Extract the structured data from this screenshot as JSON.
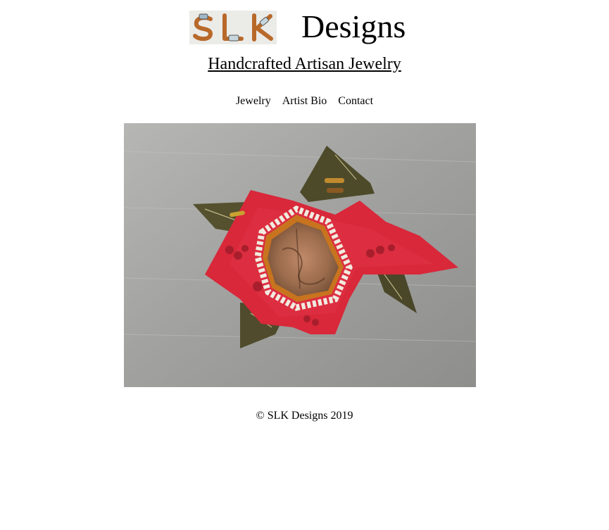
{
  "header": {
    "logo_text": "SLK",
    "site_name": "Designs",
    "tagline": "Handcrafted Artisan Jewelry"
  },
  "nav": {
    "items": [
      {
        "label": "Jewelry"
      },
      {
        "label": "Artist Bio"
      },
      {
        "label": "Contact"
      }
    ]
  },
  "hero": {
    "image_subject": "red leather brooch with jasper cabochon and beadwork on metal background"
  },
  "footer": {
    "copyright": "© SLK Designs 2019"
  },
  "colors": {
    "text": "#000000",
    "background": "#ffffff",
    "logo_letters": "#b8692a",
    "brooch_red": "#d8283a",
    "leaf_green": "#4d4a2a",
    "metal_bg": "#9a9a98"
  }
}
